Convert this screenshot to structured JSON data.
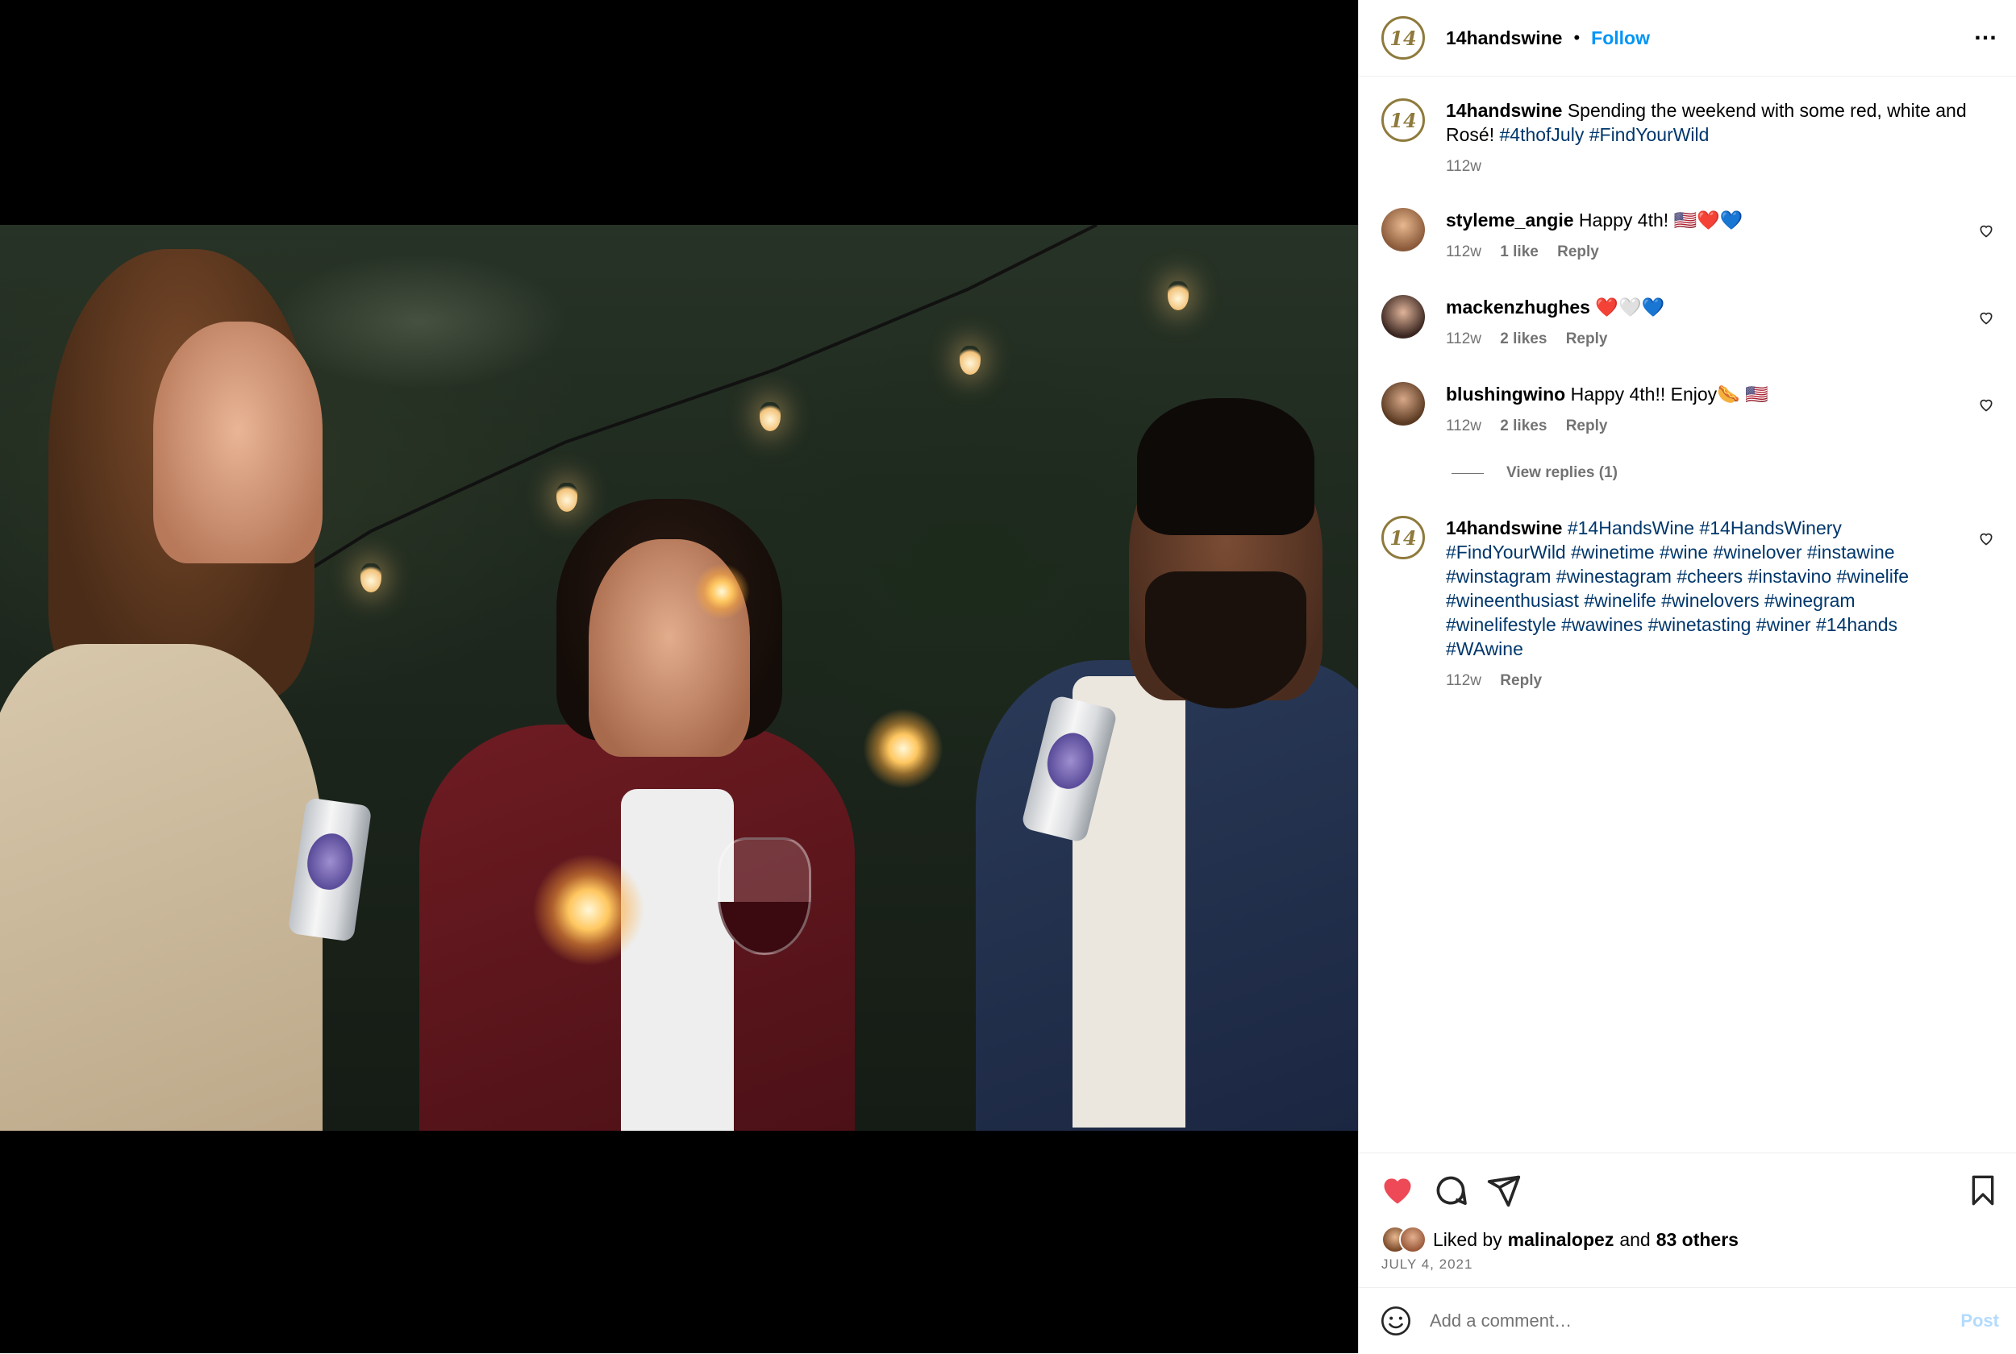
{
  "post": {
    "username": "14handswine",
    "avatar_text": "14",
    "follow_label": "Follow",
    "more_label": "…"
  },
  "caption": {
    "username": "14handswine",
    "text": "Spending the weekend with some red, white and Rosé!",
    "tags": "#4thofJuly #FindYourWild",
    "time": "112w"
  },
  "comments": [
    {
      "username": "styleme_angie",
      "text": "Happy 4th! 🇺🇸❤️💙",
      "time": "112w",
      "likes": "1 like",
      "reply": "Reply"
    },
    {
      "username": "mackenzhughes",
      "text": "❤️🤍💙",
      "time": "112w",
      "likes": "2 likes",
      "reply": "Reply"
    },
    {
      "username": "blushingwino",
      "text": "Happy 4th!! Enjoy🌭 🇺🇸",
      "time": "112w",
      "likes": "2 likes",
      "reply": "Reply",
      "view_replies": "View replies (1)"
    },
    {
      "username": "14handswine",
      "tags": "#14HandsWine #14HandsWinery #FindYourWild #winetime #wine #winelover #instawine #winstagram #winestagram #cheers #instavino #winelife #wineenthusiast #winelife #winelovers #winegram #winelifestyle #wawines #winetasting #winer #14hands #WAwine",
      "time": "112w",
      "reply": "Reply"
    }
  ],
  "likes": {
    "prefix": "Liked by",
    "user": "malinalopez",
    "and": "and",
    "others": "83 others",
    "date": "JULY 4, 2021"
  },
  "add_comment": {
    "placeholder": "Add a comment…",
    "post_label": "Post"
  },
  "colors": {
    "link": "#0095f6",
    "hashtag": "#00376b",
    "heart": "#ed4956",
    "brand_gold": "#8e7a3c"
  },
  "icons": [
    "heart-icon",
    "comment-icon",
    "share-icon",
    "bookmark-icon",
    "emoji-icon",
    "more-icon"
  ]
}
